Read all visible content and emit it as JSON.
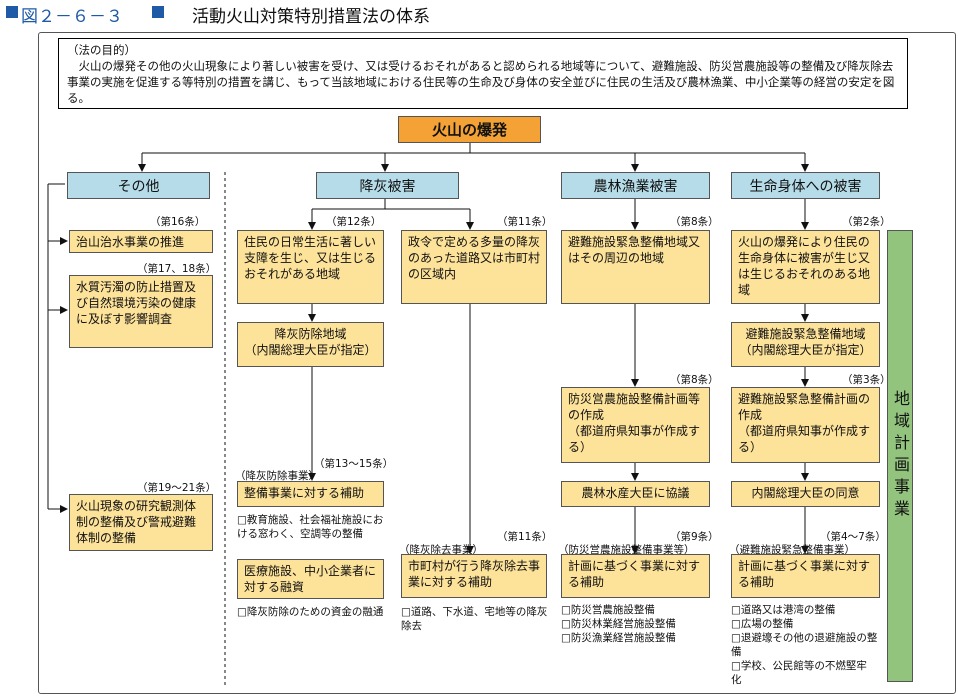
{
  "title": {
    "figure_no": "図２－６－３",
    "name": "活動火山対策特別措置法の体系"
  },
  "purpose": {
    "label": "（法の目的）",
    "text": "火山の爆発その他の火山現象により著しい被害を受け、又は受けるおそれがあると認められる地域等について、避難施設、防災営農施設等の整備及び降灰除去事業の実施を促進する等特別の措置を講じ、もって当該地域における住民等の生命及び身体の安全並びに住民の生活及び農林漁業、中小企業等の経営の安定を図る。"
  },
  "root": "火山の爆発",
  "headers": {
    "other": "その他",
    "ash": "降灰被害",
    "agri": "農林漁業被害",
    "life": "生命身体への被害"
  },
  "other": {
    "ref1": "（第16条）",
    "box1": "治山治水事業の推進",
    "ref2": "（第17、18条）",
    "box2": "水質汚濁の防止措置及び自然環境汚染の健康に及ぼす影響調査",
    "ref3": "（第19～21条）",
    "box3": "火山現象の研究観測体制の整備及び警戒避難体制の整備"
  },
  "ash_a": {
    "ref1": "（第12条）",
    "box1": "住民の日常生活に著しい支障を生じ、又は生じるおそれがある地域",
    "box2": "降灰防除地域\n（内閣総理大臣が指定）",
    "ref3": "（第13～15条）",
    "cat3": "（降灰防除事業）",
    "box3": "整備事業に対する補助",
    "note3": "□教育施設、社会福祉施設における窓わく、空調等の整備",
    "box4": "医療施設、中小企業者に対する融資",
    "note4": "□降灰防除のための資金の融通"
  },
  "ash_b": {
    "ref1": "（第11条）",
    "box1": "政令で定める多量の降灰のあった道路又は市町村の区域内",
    "ref2": "（第11条）",
    "cat2": "（降灰除去事業）",
    "box2": "市町村が行う降灰除去事業に対する補助",
    "note2": "□道路、下水道、宅地等の降灰除去"
  },
  "agri": {
    "ref1": "（第8条）",
    "box1": "避難施設緊急整備地域又はその周辺の地域",
    "ref2": "（第8条）",
    "box2": "防災営農施設整備計画等の作成\n（都道府県知事が作成する）",
    "box3": "農林水産大臣に協議",
    "ref4": "（第9条）",
    "cat4": "（防災営農施設整備事業等）",
    "box4": "計画に基づく事業に対する補助",
    "notes": [
      "□防災営農施設整備",
      "□防災林業経営施設整備",
      "□防災漁業経営施設整備"
    ]
  },
  "life": {
    "ref1": "（第2条）",
    "box1": "火山の爆発により住民の生命身体に被害が生じ又は生じるおそれのある地域",
    "box2": "避難施設緊急整備地域\n（内閣総理大臣が指定）",
    "ref3": "（第3条）",
    "box3": "避難施設緊急整備計画の作成\n（都道府県知事が作成する）",
    "box4": "内閣総理大臣の同意",
    "ref5": "（第4～7条）",
    "cat5": "（避難施設緊急整備事業）",
    "box5": "計画に基づく事業に対する補助",
    "notes": [
      "□道路又は港湾の整備",
      "□広場の整備",
      "□退避壕その他の退避施設の整備",
      "□学校、公民館等の不燃堅牢化"
    ]
  },
  "side_label": "地域計画事業"
}
